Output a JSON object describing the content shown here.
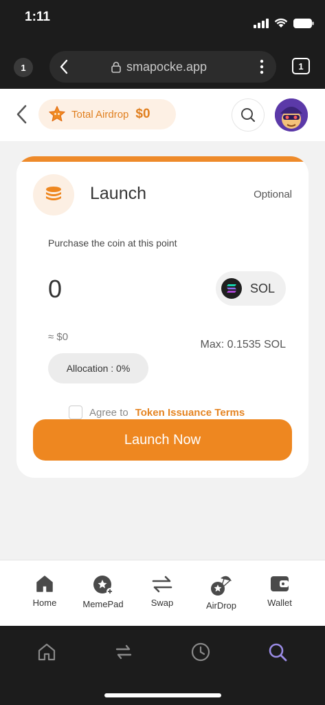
{
  "status_bar": {
    "time": "1:11"
  },
  "browser": {
    "left_tab_badge": "1",
    "url": "smapocke.app",
    "tabs_count": "1"
  },
  "header": {
    "airdrop_label": "Total Airdrop",
    "airdrop_value": "$0"
  },
  "card": {
    "title": "Launch",
    "optional_label": "Optional",
    "subtitle": "Purchase the coin at this point",
    "amount": "0",
    "currency": "SOL",
    "approx_value": "≈ $0",
    "max_label": "Max: 0.1535 SOL",
    "allocation_label": "Allocation : 0%",
    "agree_text": "Agree to",
    "terms_link": "Token Issuance Terms",
    "launch_button": "Launch Now"
  },
  "app_nav": {
    "items": [
      {
        "label": "Home",
        "icon": "home-icon"
      },
      {
        "label": "MemePad",
        "icon": "memepad-icon"
      },
      {
        "label": "Swap",
        "icon": "swap-icon"
      },
      {
        "label": "AirDrop",
        "icon": "airdrop-icon"
      },
      {
        "label": "Wallet",
        "icon": "wallet-icon"
      }
    ],
    "active_index": 4
  },
  "browser_toolbar": {
    "items": [
      "home-icon",
      "swap-arrows-icon",
      "history-icon",
      "search-icon"
    ],
    "active_index": 3
  },
  "colors": {
    "accent": "#ee8720",
    "accent_light": "#fdf0e4",
    "active_tab": "#8a7cd8"
  }
}
